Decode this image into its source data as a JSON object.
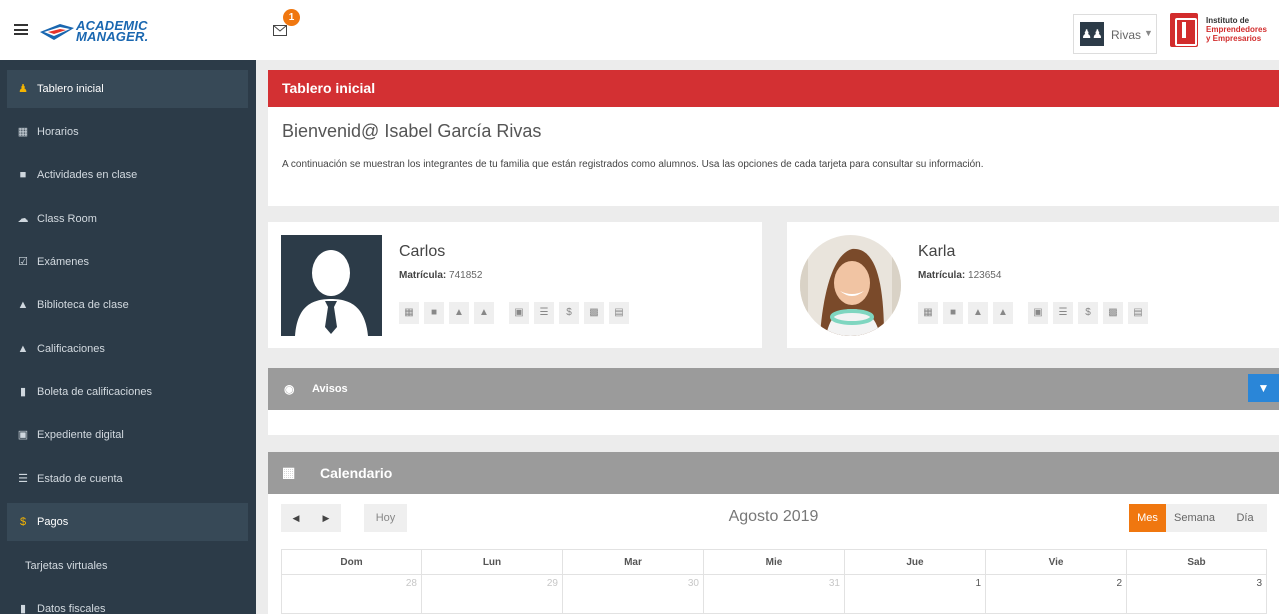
{
  "topbar": {
    "logo_line1": "ACADEMIC",
    "logo_line2": "MANAGER.",
    "mail_badge": "1",
    "user_name": "Rivas",
    "institution_line1": "Instituto de",
    "institution_line2": "Emprendedores",
    "institution_line3": "y Empresarios"
  },
  "sidebar": {
    "items": [
      {
        "label": "Tablero inicial",
        "icon": "user-icon"
      },
      {
        "label": "Horarios",
        "icon": "calendar-icon"
      },
      {
        "label": "Actividades en clase",
        "icon": "briefcase-icon"
      },
      {
        "label": "Class Room",
        "icon": "cloud-icon"
      },
      {
        "label": "Exámenes",
        "icon": "checkbox-icon"
      },
      {
        "label": "Biblioteca de clase",
        "icon": "folder-icon"
      },
      {
        "label": "Calificaciones",
        "icon": "graduation-cap-icon"
      },
      {
        "label": "Boleta de calificaciones",
        "icon": "file-icon"
      },
      {
        "label": "Expediente digital",
        "icon": "archive-icon"
      },
      {
        "label": "Estado de cuenta",
        "icon": "list-icon"
      },
      {
        "label": "Pagos",
        "icon": "dollar-icon"
      },
      {
        "label": "Tarjetas virtuales",
        "icon": ""
      },
      {
        "label": "Datos fiscales",
        "icon": "bookmark-icon"
      }
    ]
  },
  "main": {
    "header": "Tablero inicial",
    "welcome_title": "Bienvenid@ Isabel García Rivas",
    "welcome_text": "A continuación se muestran los integrantes de tu familia que están registrados como alumnos. Usa las opciones de cada tarjeta para consultar su información.",
    "students": [
      {
        "name": "Carlos",
        "matricula_label": "Matrícula:",
        "matricula": "741852"
      },
      {
        "name": "Karla",
        "matricula_label": "Matrícula:",
        "matricula": "123654"
      }
    ],
    "avisos_title": "Avisos",
    "calendar": {
      "title": "Calendario",
      "month": "Agosto 2019",
      "today_label": "Hoy",
      "views": [
        "Mes",
        "Semana",
        "Día"
      ],
      "active_view": "Mes",
      "day_names": [
        "Dom",
        "Lun",
        "Mar",
        "Mie",
        "Jue",
        "Vie",
        "Sab"
      ],
      "first_week": [
        "28",
        "29",
        "30",
        "31",
        "1",
        "2",
        "3"
      ]
    }
  },
  "colors": {
    "sidebar_bg": "#2c3b48",
    "header_red": "#d33033",
    "accent_orange": "#f0770f",
    "filter_blue": "#2a86d8"
  }
}
